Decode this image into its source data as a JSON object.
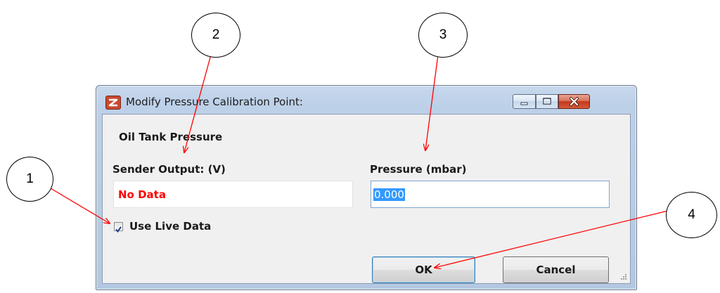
{
  "window": {
    "title": "Modify Pressure Calibration Point:",
    "icon": "app-logo-icon",
    "controls": [
      "minimize-icon",
      "maximize-icon",
      "close-icon"
    ]
  },
  "form": {
    "section_heading": "Oil Tank Pressure",
    "sender_label": "Sender Output: (V)",
    "sender_value": "No Data",
    "pressure_label": "Pressure (mbar)",
    "pressure_value": "0.000",
    "live_data_label": "Use Live Data",
    "live_data_checked": true
  },
  "buttons": {
    "ok": "OK",
    "cancel": "Cancel"
  },
  "callouts": [
    "1",
    "2",
    "3",
    "4"
  ],
  "colors": {
    "error_text": "#ff0000",
    "selection": "#3399ff",
    "annotation_arrow": "#ff0000"
  }
}
